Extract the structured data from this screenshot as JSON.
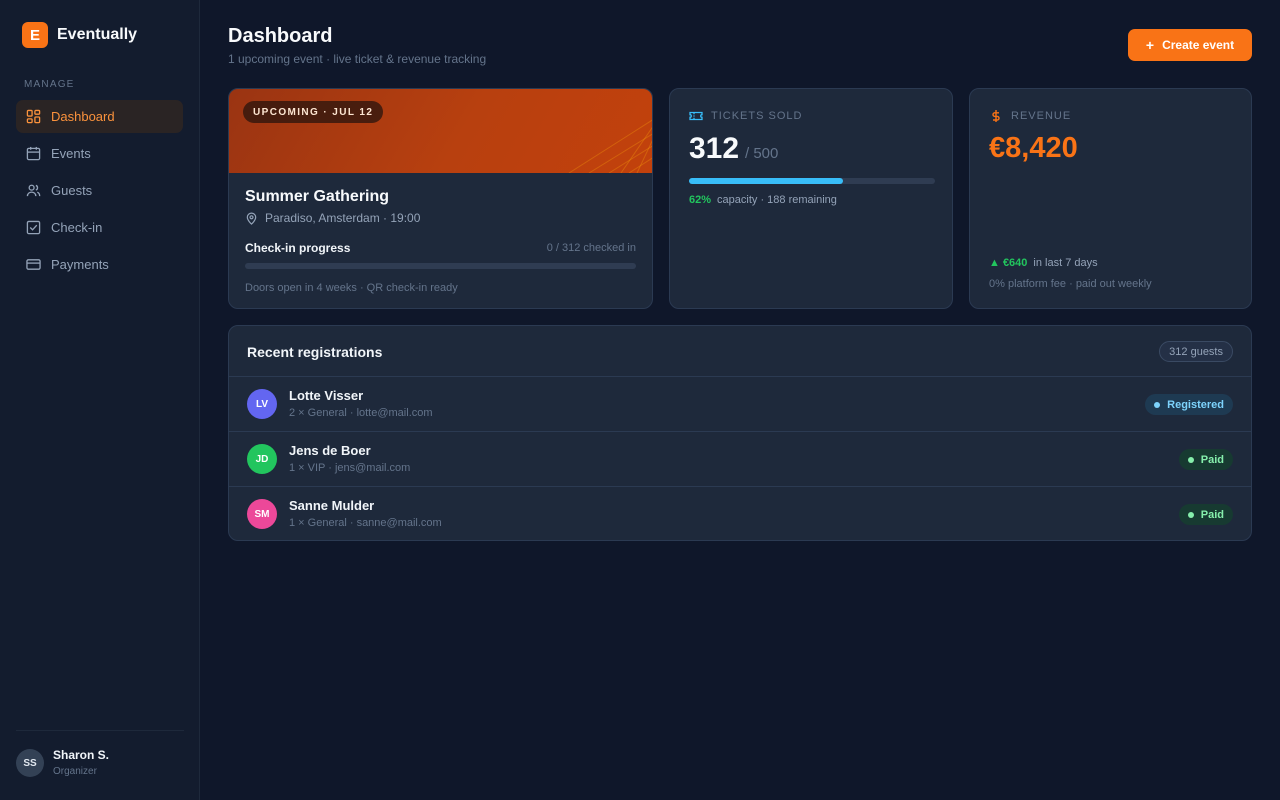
{
  "brand": {
    "logo_letter": "E",
    "name": "Eventually"
  },
  "sidebar": {
    "section_label": "MANAGE",
    "items": [
      {
        "label": "Dashboard",
        "icon": "dashboard-icon",
        "active": true
      },
      {
        "label": "Events",
        "icon": "calendar-icon",
        "active": false
      },
      {
        "label": "Guests",
        "icon": "users-icon",
        "active": false
      },
      {
        "label": "Check-in",
        "icon": "check-square-icon",
        "active": false
      },
      {
        "label": "Payments",
        "icon": "credit-card-icon",
        "active": false
      }
    ],
    "user": {
      "initials": "SS",
      "name": "Sharon S.",
      "role": "Organizer"
    }
  },
  "header": {
    "title": "Dashboard",
    "subtitle": "1 upcoming event · live ticket & revenue tracking",
    "create_button": "Create event"
  },
  "event": {
    "badge": "UPCOMING · JUL 12",
    "title": "Summer Gathering",
    "location": "Paradiso, Amsterdam · 19:00",
    "checkin_label": "Check-in progress",
    "checkin_count": "0 / 312 checked in",
    "checkin_progress": 0,
    "note": "Doors open in 4 weeks · QR check-in ready"
  },
  "tickets": {
    "label": "TICKETS SOLD",
    "sold": "312",
    "total": "/ 500",
    "progress": 0.624,
    "percent": "62%",
    "footer": "capacity · 188 remaining"
  },
  "revenue": {
    "label": "REVENUE",
    "amount": "€8,420",
    "delta": "▲ €640",
    "delta_note": "in last 7 days",
    "note": "0% platform fee · paid out weekly"
  },
  "registrations": {
    "title": "Recent registrations",
    "count": "312 guests",
    "rows": [
      {
        "initials": "LV",
        "name": "Lotte Visser",
        "meta": "2 × General · lotte@mail.com",
        "status": "Registered",
        "avatar_color": "#6366f1",
        "status_bg": "#1e3a52",
        "status_fg": "#7dd3fc",
        "dot": "#7dd3fc"
      },
      {
        "initials": "JD",
        "name": "Jens de Boer",
        "meta": "1 × VIP · jens@mail.com",
        "status": "Paid",
        "avatar_color": "#22c55e",
        "status_bg": "#173a31",
        "status_fg": "#86efac",
        "dot": "#86efac"
      },
      {
        "initials": "SM",
        "name": "Sanne Mulder",
        "meta": "1 × General · sanne@mail.com",
        "status": "Paid",
        "avatar_color": "#ec4899",
        "status_bg": "#173a31",
        "status_fg": "#86efac",
        "dot": "#86efac"
      }
    ]
  }
}
